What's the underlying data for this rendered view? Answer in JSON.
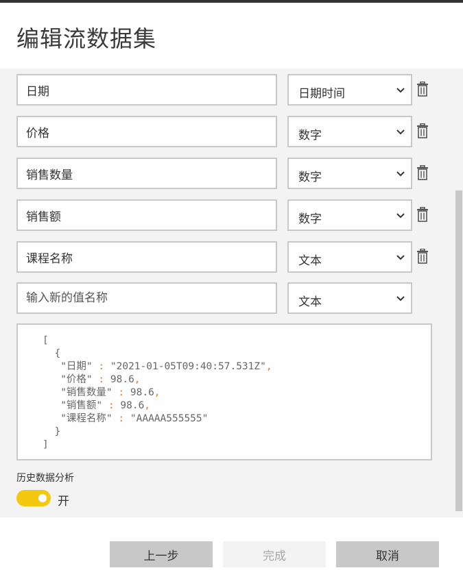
{
  "dialog": {
    "title": "编辑流数据集"
  },
  "fields": [
    {
      "name": "日期",
      "type": "日期时间",
      "deletable": true
    },
    {
      "name": "价格",
      "type": "数字",
      "deletable": true
    },
    {
      "name": "销售数量",
      "type": "数字",
      "deletable": true
    },
    {
      "name": "销售额",
      "type": "数字",
      "deletable": true
    },
    {
      "name": "课程名称",
      "type": "文本",
      "deletable": true
    }
  ],
  "new_field": {
    "placeholder": "输入新的值名称",
    "type": "文本"
  },
  "json_preview": {
    "open_bracket": "[",
    "open_brace": "{",
    "lines": [
      {
        "key": "\"日期\"",
        "value": "\"2021-01-05T09:40:57.531Z\"",
        "comma": ","
      },
      {
        "key": "\"价格\"",
        "value": "98.6",
        "comma": ","
      },
      {
        "key": "\"销售数量\"",
        "value": "98.6",
        "comma": ","
      },
      {
        "key": "\"销售额\"",
        "value": "98.6",
        "comma": ","
      },
      {
        "key": "\"课程名称\"",
        "value": "\"AAAAA555555\"",
        "comma": ""
      }
    ],
    "separator": ":",
    "close_brace": "}",
    "close_bracket": "]"
  },
  "historical_analysis": {
    "label": "历史数据分析",
    "toggle_state": "开",
    "enabled": true
  },
  "footer": {
    "back_label": "上一步",
    "done_label": "完成",
    "cancel_label": "取消"
  },
  "colors": {
    "accent_toggle": "#f2c811",
    "json_punctuation": "#e07a3a",
    "panel_bg": "#f3f3f3",
    "border": "#c8c8c8"
  }
}
